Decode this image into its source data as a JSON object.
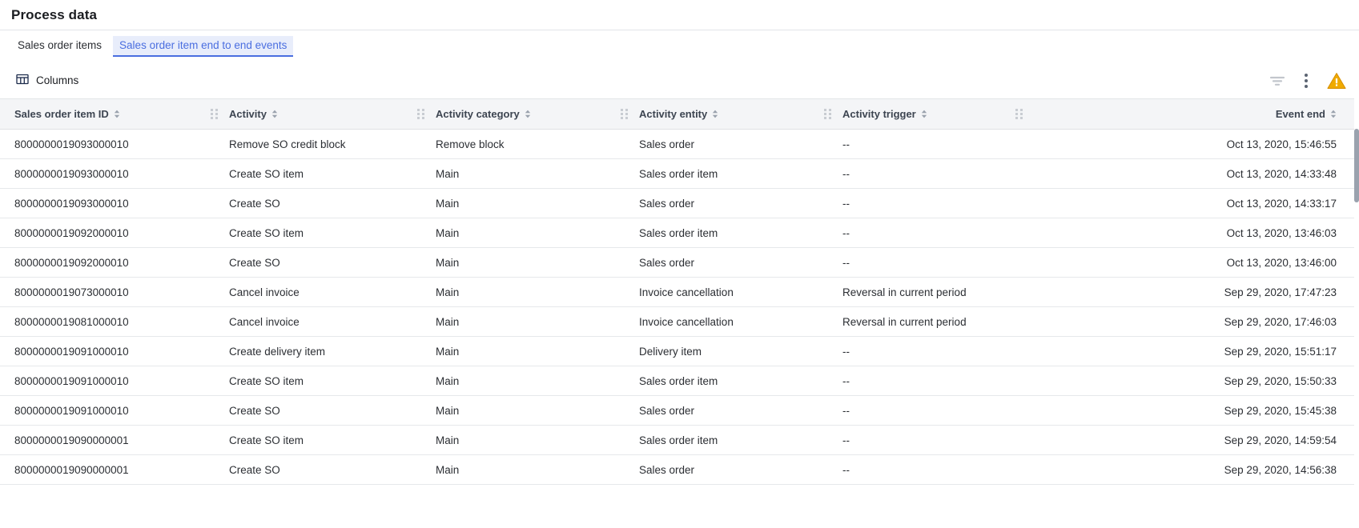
{
  "page": {
    "title": "Process data"
  },
  "tabs": [
    {
      "label": "Sales order items",
      "active": false
    },
    {
      "label": "Sales order item end to end events",
      "active": true
    }
  ],
  "toolbar": {
    "columns_label": "Columns",
    "columns_icon": "table-columns-icon",
    "filter_icon": "filter-icon",
    "more_icon": "more-vertical-icon",
    "warning_icon": "warning-triangle-icon"
  },
  "colors": {
    "accent": "#4a6ee0",
    "tab_active_bg": "#e8edfb",
    "header_bg": "#f4f5f7",
    "warning": "#f0ab00",
    "text": "#2b2e33"
  },
  "table": {
    "columns": [
      {
        "label": "Sales order item ID",
        "align": "left",
        "sortable": true
      },
      {
        "label": "Activity",
        "align": "left",
        "sortable": true
      },
      {
        "label": "Activity category",
        "align": "left",
        "sortable": true
      },
      {
        "label": "Activity entity",
        "align": "left",
        "sortable": true
      },
      {
        "label": "Activity trigger",
        "align": "left",
        "sortable": true
      },
      {
        "label": "Event end",
        "align": "right",
        "sortable": true
      }
    ],
    "rows": [
      {
        "id": "8000000019093000010",
        "activity": "Remove SO credit block",
        "category": "Remove block",
        "entity": "Sales order",
        "trigger": "--",
        "event_end": "Oct 13, 2020, 15:46:55"
      },
      {
        "id": "8000000019093000010",
        "activity": "Create SO item",
        "category": "Main",
        "entity": "Sales order item",
        "trigger": "--",
        "event_end": "Oct 13, 2020, 14:33:48"
      },
      {
        "id": "8000000019093000010",
        "activity": "Create SO",
        "category": "Main",
        "entity": "Sales order",
        "trigger": "--",
        "event_end": "Oct 13, 2020, 14:33:17"
      },
      {
        "id": "8000000019092000010",
        "activity": "Create SO item",
        "category": "Main",
        "entity": "Sales order item",
        "trigger": "--",
        "event_end": "Oct 13, 2020, 13:46:03"
      },
      {
        "id": "8000000019092000010",
        "activity": "Create SO",
        "category": "Main",
        "entity": "Sales order",
        "trigger": "--",
        "event_end": "Oct 13, 2020, 13:46:00"
      },
      {
        "id": "8000000019073000010",
        "activity": "Cancel invoice",
        "category": "Main",
        "entity": "Invoice cancellation",
        "trigger": "Reversal in current period",
        "event_end": "Sep 29, 2020, 17:47:23"
      },
      {
        "id": "8000000019081000010",
        "activity": "Cancel invoice",
        "category": "Main",
        "entity": "Invoice cancellation",
        "trigger": "Reversal in current period",
        "event_end": "Sep 29, 2020, 17:46:03"
      },
      {
        "id": "8000000019091000010",
        "activity": "Create delivery item",
        "category": "Main",
        "entity": "Delivery item",
        "trigger": "--",
        "event_end": "Sep 29, 2020, 15:51:17"
      },
      {
        "id": "8000000019091000010",
        "activity": "Create SO item",
        "category": "Main",
        "entity": "Sales order item",
        "trigger": "--",
        "event_end": "Sep 29, 2020, 15:50:33"
      },
      {
        "id": "8000000019091000010",
        "activity": "Create SO",
        "category": "Main",
        "entity": "Sales order",
        "trigger": "--",
        "event_end": "Sep 29, 2020, 15:45:38"
      },
      {
        "id": "8000000019090000001",
        "activity": "Create SO item",
        "category": "Main",
        "entity": "Sales order item",
        "trigger": "--",
        "event_end": "Sep 29, 2020, 14:59:54"
      },
      {
        "id": "8000000019090000001",
        "activity": "Create SO",
        "category": "Main",
        "entity": "Sales order",
        "trigger": "--",
        "event_end": "Sep 29, 2020, 14:56:38"
      }
    ]
  }
}
